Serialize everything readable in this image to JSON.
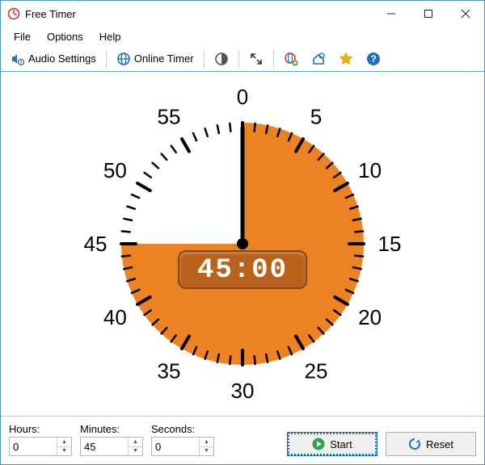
{
  "app": {
    "title": "Free Timer"
  },
  "menu": {
    "file": "File",
    "options": "Options",
    "help": "Help"
  },
  "toolbar": {
    "audio_settings": "Audio Settings",
    "online_timer": "Online Timer"
  },
  "timer": {
    "digital": "45:00",
    "minutes_set": 45,
    "dial_numbers": [
      "0",
      "5",
      "10",
      "15",
      "20",
      "25",
      "30",
      "35",
      "40",
      "45",
      "50",
      "55"
    ]
  },
  "inputs": {
    "hours_label": "Hours:",
    "minutes_label": "Minutes:",
    "seconds_label": "Seconds:",
    "hours": "0",
    "minutes": "45",
    "seconds": "0"
  },
  "buttons": {
    "start": "Start",
    "reset": "Reset"
  },
  "colors": {
    "accent": "#ed8222",
    "accent_dark": "#b8621b",
    "win_border": "#4a8fd1",
    "play_green": "#2aa850",
    "reset_blue": "#1d6fbf"
  }
}
